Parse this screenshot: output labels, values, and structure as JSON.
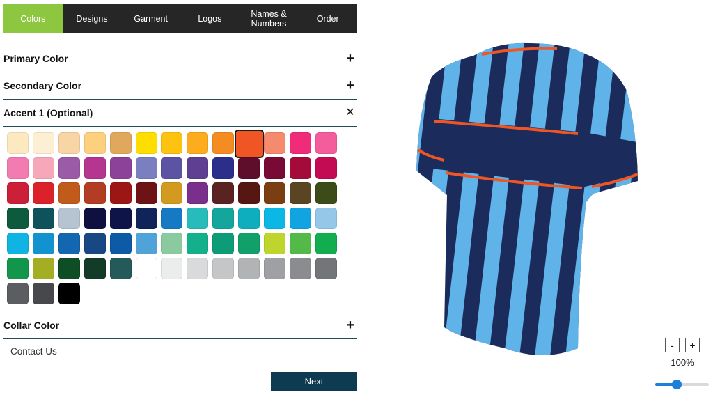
{
  "tabs": [
    {
      "label": "Colors",
      "active": true
    },
    {
      "label": "Designs",
      "active": false
    },
    {
      "label": "Garment",
      "active": false
    },
    {
      "label": "Logos",
      "active": false
    },
    {
      "label": "Names &\nNumbers",
      "active": false
    },
    {
      "label": "Order",
      "active": false
    }
  ],
  "sections": {
    "primary": {
      "label": "Primary Color",
      "toggle": "+"
    },
    "secondary": {
      "label": "Secondary Color",
      "toggle": "+"
    },
    "accent": {
      "label": "Accent 1 (Optional)",
      "toggle": "✕"
    },
    "collar": {
      "label": "Collar Color",
      "toggle": "+"
    }
  },
  "palette": {
    "selected_index": 9,
    "colors": [
      "#fde9c0",
      "#fdefd3",
      "#f8d5a4",
      "#fcd07f",
      "#e0a85c",
      "#fede00",
      "#fec210",
      "#fcac1c",
      "#f48c22",
      "#f05524",
      "#f58a6e",
      "#ef2b7a",
      "#f35d9b",
      "#f27bb1",
      "#f6a8b8",
      "#9c5ba7",
      "#b5368f",
      "#8c4298",
      "#7a7fc0",
      "#5c53a3",
      "#5e3f91",
      "#2b2e8a",
      "#5e0e2b",
      "#780a35",
      "#a50b3a",
      "#c30b54",
      "#cc2039",
      "#db2129",
      "#c15b1b",
      "#b23c24",
      "#9c1616",
      "#6d1316",
      "#d29b1f",
      "#7a2f8d",
      "#5a2321",
      "#561713",
      "#7a3e12",
      "#5a4522",
      "#3b4c18",
      "#0e5a3e",
      "#0e535c",
      "#b6c4d1",
      "#101040",
      "#0f1448",
      "#0f2458",
      "#157ac3",
      "#28bbbb",
      "#14a59c",
      "#0eaebf",
      "#0bb8e5",
      "#11a4e0",
      "#94c7e8",
      "#0fb4e2",
      "#1293cf",
      "#1267b0",
      "#174883",
      "#0d5aa7",
      "#4fa3d9",
      "#8bca9e",
      "#14b08c",
      "#0e9c78",
      "#11a069",
      "#bed52d",
      "#53b948",
      "#11ad4f",
      "#11964b",
      "#a3ae24",
      "#0f4d25",
      "#123b28",
      "#245a5a",
      "#ffffff",
      "#ebedec",
      "#d9dadb",
      "#c5c6c8",
      "#b2b3b5",
      "#9fa0a3",
      "#8b8c8f",
      "#747578",
      "#5b5d61",
      "#46484c",
      "#000000"
    ]
  },
  "contact_label": "Contact Us",
  "next_label": "Next",
  "zoom": {
    "minus": "-",
    "plus": "+",
    "level_text": "100%",
    "slider_value": 0.4
  },
  "jersey_colors": {
    "navy": "#1b2c5c",
    "sky": "#5fb3e8",
    "orange": "#f05524"
  }
}
